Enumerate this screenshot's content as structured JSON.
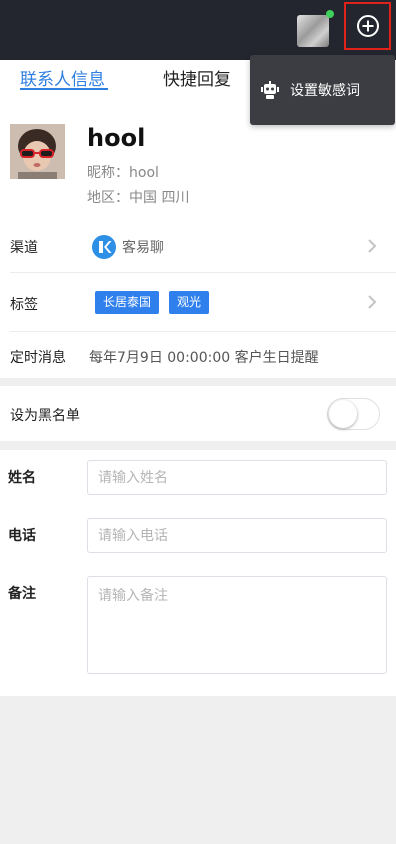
{
  "header": {
    "avatar": "user-avatar",
    "online_status_color": "#3ed05a",
    "add_button_icon": "plus-circle-icon"
  },
  "tabs": [
    {
      "label": "联系人信息",
      "active": true
    },
    {
      "label": "快捷回复",
      "active": false
    }
  ],
  "dropdown_menu": {
    "items": [
      {
        "icon": "robot-icon",
        "label": "设置敏感词"
      }
    ]
  },
  "contact": {
    "name": "hool",
    "nickname": "昵称：hool",
    "region": "地区：中国 四川"
  },
  "channel": {
    "label": "渠道",
    "value": "客易聊",
    "icon": "kyl-logo-icon"
  },
  "tags": {
    "label": "标签",
    "items": [
      "长居泰国",
      "观光"
    ]
  },
  "schedule": {
    "label": "定时消息",
    "value": "每年7月9日 00:00:00 客户生日提醒"
  },
  "blacklist": {
    "label": "设为黑名单",
    "enabled": false
  },
  "form": {
    "name": {
      "label": "姓名",
      "placeholder": "请输入姓名",
      "value": ""
    },
    "phone": {
      "label": "电话",
      "placeholder": "请输入电话",
      "value": ""
    },
    "note": {
      "label": "备注",
      "placeholder": "请输入备注",
      "value": ""
    }
  },
  "colors": {
    "accent": "#2f7fe0",
    "tag_bg": "#2f80ed",
    "topbar_bg": "#23262f",
    "highlight_border": "#e0221b"
  }
}
